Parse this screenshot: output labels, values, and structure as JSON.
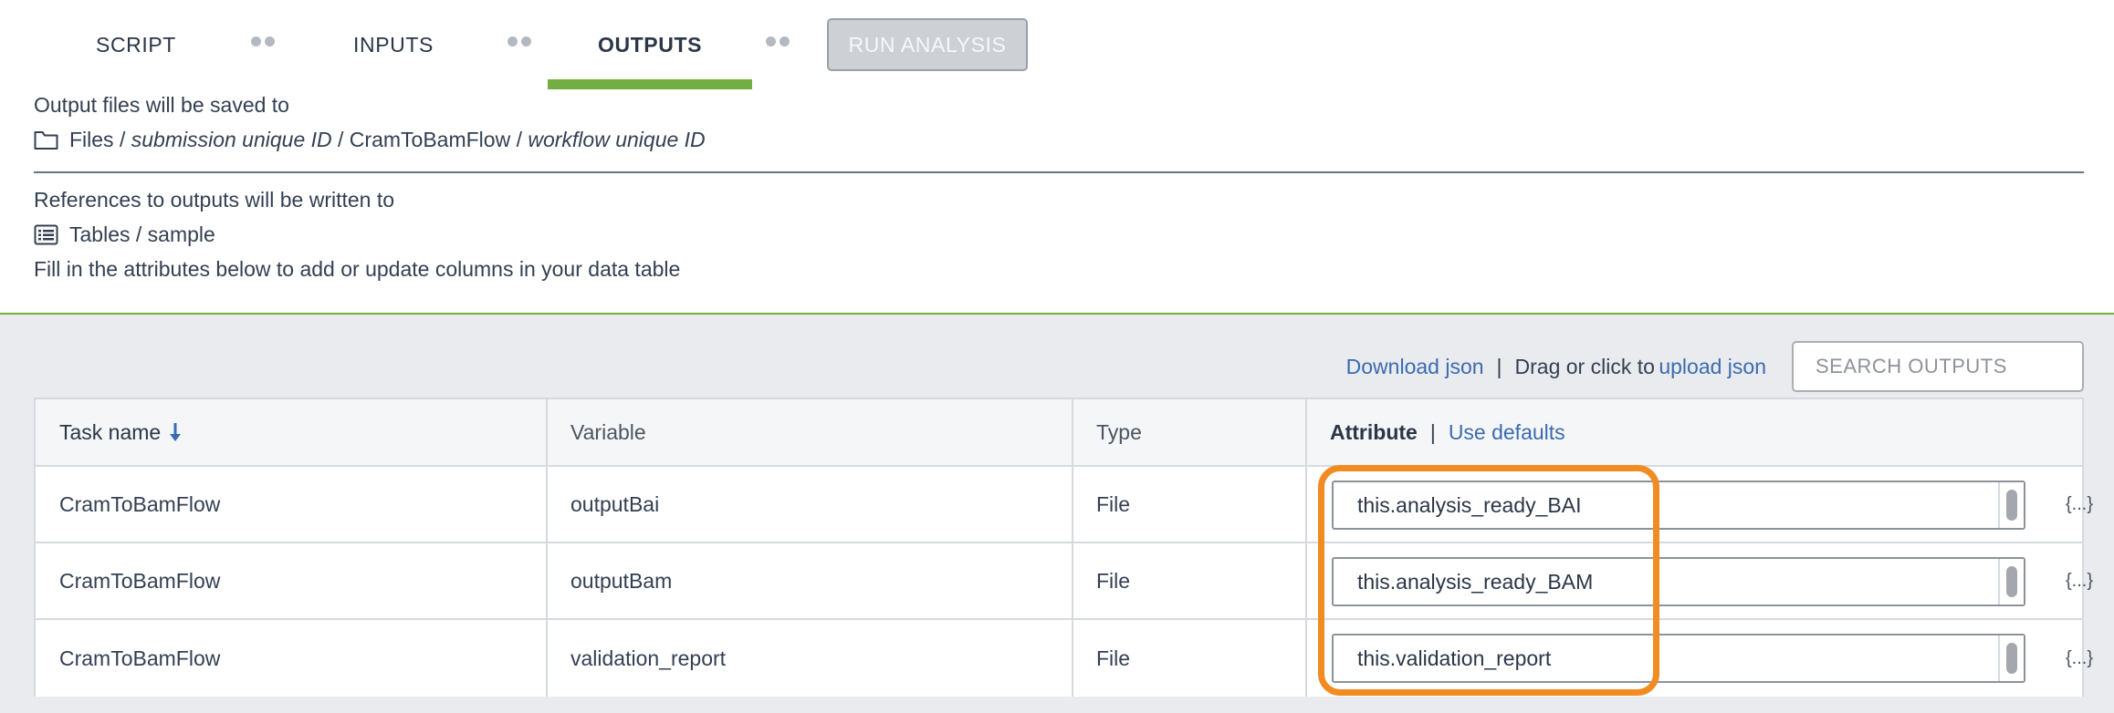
{
  "tabs": [
    {
      "label": "SCRIPT"
    },
    {
      "label": "INPUTS"
    },
    {
      "label": "OUTPUTS"
    }
  ],
  "run_button": {
    "label": "RUN ANALYSIS"
  },
  "output_files": {
    "heading": "Output files will be saved to",
    "path_prefix": "Files /",
    "submission_id": "submission unique ID",
    "workflow_segment": "/ CramToBamFlow /",
    "workflow_id": "workflow unique ID"
  },
  "references": {
    "heading": "References to outputs will be written to",
    "table_path": "Tables / sample",
    "instructions": "Fill in the attributes below to add or update columns in your data table"
  },
  "toolbar": {
    "download_json": "Download json",
    "separator": "|",
    "drag_text": "Drag or click to",
    "upload_json": "upload json",
    "search_placeholder": "SEARCH OUTPUTS"
  },
  "table": {
    "headers": {
      "task_name": "Task name",
      "variable": "Variable",
      "type": "Type",
      "attribute": "Attribute",
      "separator": "|",
      "use_defaults": "Use defaults"
    },
    "rows": [
      {
        "task": "CramToBamFlow",
        "variable": "outputBai",
        "type": "File",
        "attribute": "this.analysis_ready_BAI",
        "braces": "{...}"
      },
      {
        "task": "CramToBamFlow",
        "variable": "outputBam",
        "type": "File",
        "attribute": "this.analysis_ready_BAM",
        "braces": "{...}"
      },
      {
        "task": "CramToBamFlow",
        "variable": "validation_report",
        "type": "File",
        "attribute": "this.validation_report",
        "braces": "{...}"
      }
    ]
  },
  "colors": {
    "accent_green": "#74ae43",
    "highlight_orange": "#f28b22",
    "link_blue": "#3b6bb0"
  },
  "icons": {
    "folder": "folder-icon",
    "table": "table-list-icon",
    "sort": "arrow-down-icon"
  }
}
